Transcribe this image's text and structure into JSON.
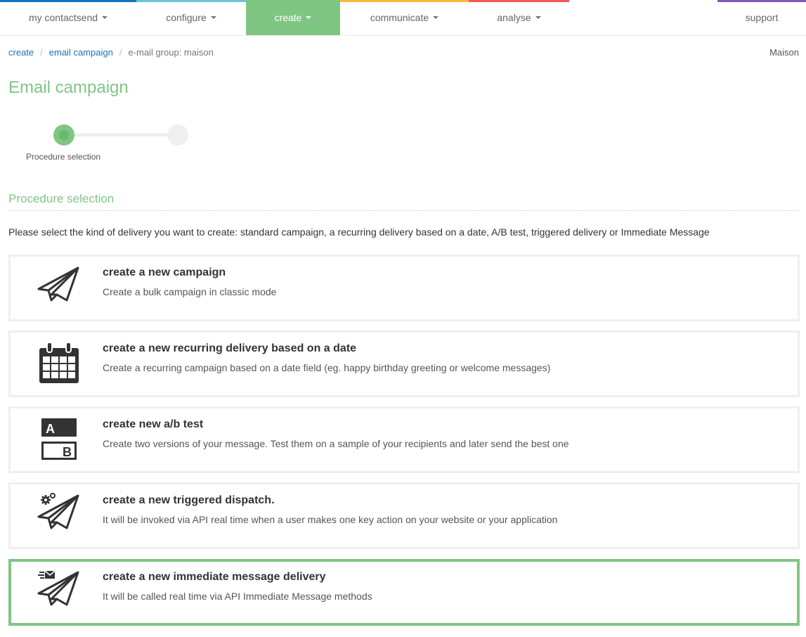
{
  "nav": {
    "items": [
      {
        "label": "my contactsend",
        "color": "#0f72ba",
        "has_caret": true,
        "active": false
      },
      {
        "label": "configure",
        "color": "#6cc3d5",
        "has_caret": true,
        "active": false
      },
      {
        "label": "create",
        "color": "#7fc683",
        "has_caret": true,
        "active": true
      },
      {
        "label": "communicate",
        "color": "#fbb837",
        "has_caret": true,
        "active": false
      },
      {
        "label": "analyse",
        "color": "#f25656",
        "has_caret": true,
        "active": false
      },
      {
        "label": "support",
        "color": "#7e58c2",
        "has_caret": false,
        "active": false
      }
    ]
  },
  "breadcrumb": {
    "items": [
      {
        "label": "create",
        "link": true
      },
      {
        "label": "email campaign",
        "link": true
      },
      {
        "label": "e-mail group: maison",
        "link": false
      }
    ],
    "separator": "/"
  },
  "account": "Maison",
  "page_title": "Email campaign",
  "stepper": {
    "steps": [
      {
        "label": "Procedure selection",
        "state": "active"
      },
      {
        "label": "",
        "state": "pending"
      }
    ]
  },
  "section": {
    "title": "Procedure selection",
    "intro": "Please select the kind of delivery you want to create: standard campaign, a recurring delivery based on a date, A/B test, triggered delivery or Immediate Message"
  },
  "options": [
    {
      "icon": "paper-plane-icon",
      "title": "create a new campaign",
      "description": "Create a bulk campaign in classic mode",
      "selected": false
    },
    {
      "icon": "calendar-icon",
      "title": "create a new recurring delivery based on a date",
      "description": "Create a recurring campaign based on a date field (eg. happy birthday greeting or welcome messages)",
      "selected": false
    },
    {
      "icon": "ab-test-icon",
      "title": "create new a/b test",
      "description": "Create two versions of your message. Test them on a sample of your recipients and later send the best one",
      "selected": false
    },
    {
      "icon": "triggered-plane-icon",
      "title": "create a new triggered dispatch.",
      "description": "It will be invoked via API real time when a user makes one key action on your website or your application",
      "selected": false
    },
    {
      "icon": "immediate-message-icon",
      "title": "create a new immediate message delivery",
      "description": "It will be called real time via API Immediate Message methods",
      "selected": true
    }
  ],
  "colors": {
    "accent": "#7fc683",
    "link": "#1a73b5",
    "card_border": "#efefef"
  }
}
